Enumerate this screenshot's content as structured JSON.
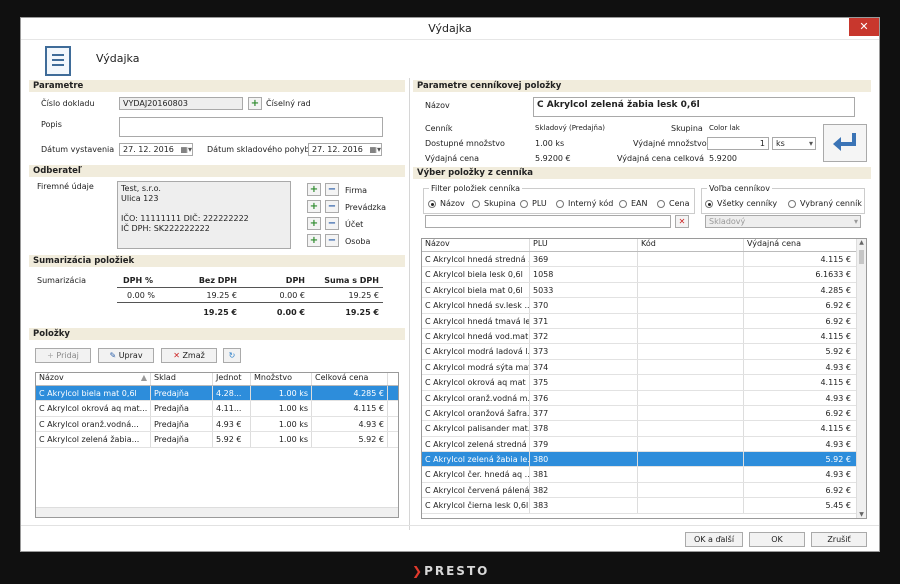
{
  "window": {
    "title": "Výdajka",
    "close": "✕"
  },
  "header": {
    "title": "Výdajka"
  },
  "params": {
    "section": "Parametre",
    "doc_no_label": "Číslo dokladu",
    "doc_no": "VYDAJ20160803",
    "numbering_label": "Číselný rad",
    "desc_label": "Popis",
    "desc": "",
    "issue_label": "Dátum vystavenia",
    "issue_date": "27. 12. 2016",
    "stock_label": "Dátum skladového pohybu",
    "stock_date": "27. 12. 2016"
  },
  "customer": {
    "section": "Odberateľ",
    "company_label": "Firemné údaje",
    "lines": [
      "Test, s.r.o.",
      "Ulica 123",
      "",
      "IČO: 11111111 DIČ: 222222222",
      "IČ DPH: SK222222222"
    ],
    "btns": [
      "Firma",
      "Prevádzka",
      "Účet",
      "Osoba"
    ]
  },
  "summary": {
    "section": "Sumarizácia položiek",
    "label": "Sumarizácia",
    "headers": [
      "DPH %",
      "Bez DPH",
      "DPH",
      "Suma s DPH"
    ],
    "row1": [
      "0.00 %",
      "19.25 €",
      "0.00 €",
      "19.25 €"
    ],
    "row2": [
      "",
      "19.25 €",
      "0.00 €",
      "19.25 €"
    ]
  },
  "items": {
    "section": "Položky",
    "add": "Pridaj",
    "edit": "Uprav",
    "delete": "Zmaž",
    "headers": [
      "Názov",
      "Sklad",
      "Jednot",
      "Množstvo",
      "Celková cena"
    ],
    "rows": [
      [
        "C Akrylcol biela mat 0,6l",
        "Predajňa",
        "4.28...",
        "1.00 ks",
        "4.285 €"
      ],
      [
        "C Akrylcol okrová aq mat...",
        "Predajňa",
        "4.11...",
        "1.00 ks",
        "4.115 €"
      ],
      [
        "C Akrylcol oranž.vodná...",
        "Predajňa",
        "4.93 €",
        "1.00 ks",
        "4.93 €"
      ],
      [
        "C Akrylcol zelená žabia...",
        "Predajňa",
        "5.92 €",
        "1.00 ks",
        "5.92 €"
      ]
    ]
  },
  "price_params": {
    "section": "Parametre cenníkovej položky",
    "name_label": "Názov",
    "name": "C Akrylcol zelená žabia lesk 0,6l",
    "pricelist_label": "Cenník",
    "pricelist": "Skladový (Predajňa)",
    "group_label": "Skupina",
    "group": "Color lak",
    "avail_label": "Dostupné množstvo",
    "avail": "1.00 ks",
    "qty_label": "Výdajné množstvo",
    "qty": "1",
    "unit": "ks",
    "price_label": "Výdajná cena",
    "price": "5.9200 €",
    "total_label": "Výdajná cena celková",
    "total": "5.9200"
  },
  "pick": {
    "section": "Výber položky z cenníka",
    "filter_label": "Filter položiek cenníka",
    "filters": [
      "Názov",
      "Skupina",
      "PLU",
      "Interný kód",
      "EAN",
      "Cena"
    ],
    "choice_label": "Voľba cenníkov",
    "choices": [
      "Všetky cenníky",
      "Vybraný cenník"
    ],
    "selected_pricelist": "Skladový",
    "search": "",
    "headers": [
      "Názov",
      "PLU",
      "Kód",
      "Výdajná cena"
    ],
    "rows": [
      [
        "C Akrylcol  hnedá stredná ...",
        "369",
        "",
        "4.115 €"
      ],
      [
        "C Akrylcol biela lesk 0,6l",
        "1058",
        "",
        "6.1633 €"
      ],
      [
        "C Akrylcol biela mat 0,6l",
        "5033",
        "",
        "4.285 €"
      ],
      [
        "C Akrylcol hnedá sv.lesk ...",
        "370",
        "",
        "6.92 €"
      ],
      [
        "C Akrylcol hnedá tmavá le...",
        "371",
        "",
        "6.92 €"
      ],
      [
        "C Akrylcol hnedá vod.mat ...",
        "372",
        "",
        "4.115 €"
      ],
      [
        "C Akrylcol modrá ladová l...",
        "373",
        "",
        "5.92 €"
      ],
      [
        "C Akrylcol modrá sýta mat...",
        "374",
        "",
        "4.93 €"
      ],
      [
        "C Akrylcol okrová aq mat ...",
        "375",
        "",
        "4.115 €"
      ],
      [
        "C Akrylcol oranž.vodná m...",
        "376",
        "",
        "4.93 €"
      ],
      [
        "C Akrylcol oranžová šafra...",
        "377",
        "",
        "6.92 €"
      ],
      [
        "C Akrylcol palisander mat...",
        "378",
        "",
        "4.115 €"
      ],
      [
        "C Akrylcol zelená stredná ...",
        "379",
        "",
        "4.93 €"
      ],
      [
        "C Akrylcol zelená žabia le...",
        "380",
        "",
        "5.92 €"
      ],
      [
        "C Akrylcol čer. hnedá aq ...",
        "381",
        "",
        "4.93 €"
      ],
      [
        "C Akrylcol červená pálená...",
        "382",
        "",
        "6.92 €"
      ],
      [
        "C Akrylcol čierna lesk 0,6l",
        "383",
        "",
        "5.45 €"
      ]
    ]
  },
  "footer": {
    "ok_next": "OK a ďalší",
    "ok": "OK",
    "cancel": "Zrušiť"
  },
  "brand": {
    "arrow": "❯",
    "name": "PRESTO"
  }
}
